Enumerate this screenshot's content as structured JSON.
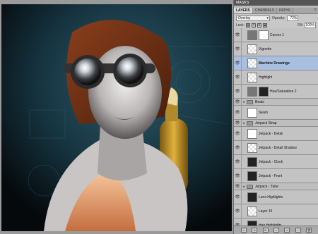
{
  "panel": {
    "masks_tab": "MASKS",
    "tabs": [
      {
        "label": "LAYERS",
        "active": true
      },
      {
        "label": "CHANNELS",
        "active": false
      },
      {
        "label": "PATHS",
        "active": false
      }
    ],
    "menu_icon": "≡",
    "blend_mode": "Overlay",
    "opacity_label": "Opacity:",
    "opacity_value": "72%",
    "lock_label": "Lock:",
    "fill_label": "Fill:",
    "fill_value": "100%"
  },
  "layers": [
    {
      "name": "Curves 1",
      "kind": "adjust",
      "selected": false
    },
    {
      "name": "Vignette",
      "kind": "trans",
      "selected": false
    },
    {
      "name": "Machine Drawings",
      "kind": "trans",
      "selected": true
    },
    {
      "name": "Highlight",
      "kind": "trans",
      "selected": false
    },
    {
      "name": "Hue/Saturation 2",
      "kind": "adjust-mask",
      "selected": false
    },
    {
      "name": "Beats",
      "kind": "group",
      "selected": false
    },
    {
      "name": "Seam",
      "kind": "white",
      "selected": false
    },
    {
      "name": "Jetpack Strap",
      "kind": "group",
      "selected": false
    },
    {
      "name": "Jetpack - Detail",
      "kind": "white",
      "selected": false
    },
    {
      "name": "Jetpack - Detail Shadow",
      "kind": "trans",
      "selected": false
    },
    {
      "name": "Jetpack - Clock",
      "kind": "dark",
      "selected": false
    },
    {
      "name": "Jetpack - Front",
      "kind": "dark",
      "selected": false
    },
    {
      "name": "Jetpack - Tube",
      "kind": "group",
      "selected": false
    },
    {
      "name": "Lens Highlights",
      "kind": "dark",
      "selected": false
    },
    {
      "name": "Layer 15",
      "kind": "trans",
      "selected": false
    },
    {
      "name": "Hair Highlights",
      "kind": "dark",
      "selected": false
    }
  ],
  "footer": {
    "buttons": [
      "link-icon",
      "fx-icon",
      "mask-icon",
      "adjustment-icon",
      "folder-icon",
      "new-layer-icon",
      "trash-icon"
    ],
    "glyphs": [
      "∞",
      "fx",
      "◘",
      "◐",
      "▭",
      "+",
      "🗑"
    ]
  },
  "colors": {
    "panel_bg": "#b9b9b9",
    "selected": "#a9bfe0",
    "canvas_bg": "#0b1418"
  }
}
